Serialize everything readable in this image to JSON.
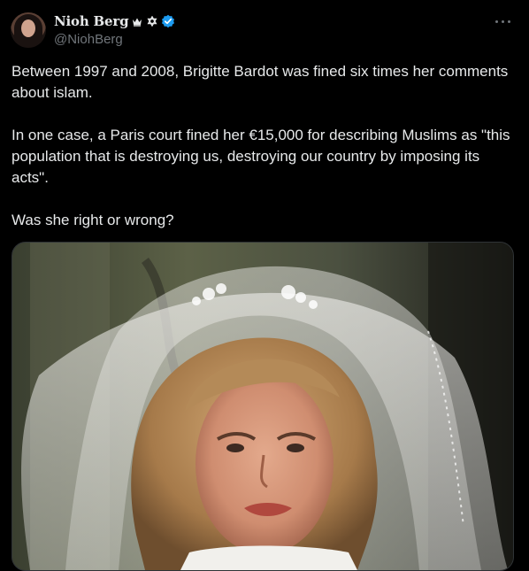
{
  "author": {
    "display_name": "Nioh Berg",
    "handle": "@NiohBerg",
    "badges": [
      "crown-icon",
      "star-of-david-icon",
      "verified-icon"
    ]
  },
  "post": {
    "paragraph_1": "Between 1997 and 2008, Brigitte Bardot was fined six times her comments about islam.",
    "paragraph_2": "In one case, a Paris court fined her €15,000 for describing Muslims as \"this population that is destroying us, destroying our country by imposing its acts\".",
    "paragraph_3": "Was she right or wrong?"
  },
  "media": {
    "type": "photo",
    "icon": "photo-icon"
  },
  "colors": {
    "background": "#000000",
    "text_primary": "#e7e9ea",
    "text_secondary": "#71767b",
    "verified_blue": "#1d9bf0"
  }
}
